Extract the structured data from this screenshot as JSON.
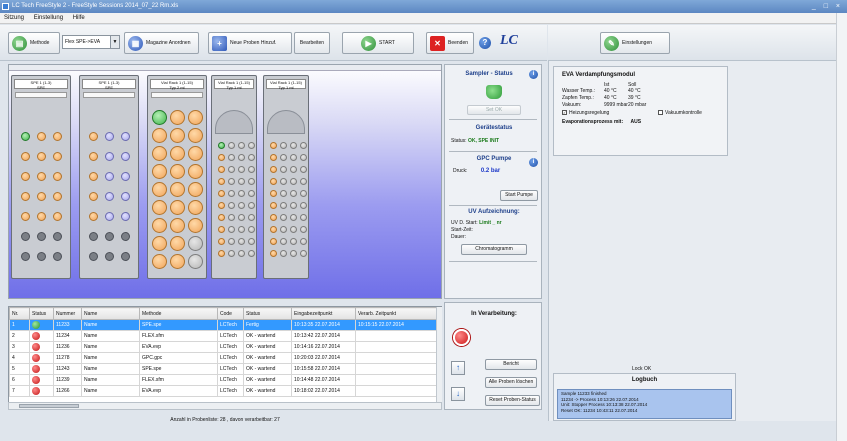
{
  "window": {
    "title": "LC Tech FreeStyle 2 - FreeStyle Sessions 2014_07_22 Rm.xls",
    "controls": "_ □ ×"
  },
  "menu": [
    "Sitzung",
    "Einstellung",
    "Hilfe"
  ],
  "toolbar": {
    "method_label": "Methode",
    "method_select": "Flex SPE->EVA",
    "magazines_label": "Magazine Anordnen",
    "new_samples_label": "Neue Proben Hinzuf.",
    "edit_label": "Bearbeiten",
    "start_label": "START",
    "quit_label": "Beenden",
    "help_glyph": "?",
    "logo_text": "LC"
  },
  "racks": [
    {
      "label": "SPE 1 (1-3)",
      "sub": "SPE"
    },
    {
      "label": "SPE 1 (1-3)",
      "sub": "SPE"
    },
    {
      "label": "Vial Rack 1 (1-15)",
      "sub": "Typ 2 ml"
    },
    {
      "label": "Vial Rack 1 (1-15)",
      "sub": "Typ 1 ml"
    },
    {
      "label": "Vial Rack 1 (1-15)",
      "sub": "Typ 1 ml"
    }
  ],
  "sampler_status": {
    "title": "Sampler - Status",
    "set_ok_label": "Set OK",
    "device_status_title": "Gerätestatus",
    "status_label": "Status:",
    "status_value": "OK, SPE INIT",
    "gpc_title": "GPC Pumpe",
    "pressure_label": "Druck:",
    "pressure_value": "0.2 bar",
    "start_pump_label": "Start Pumpe",
    "uv_title": "UV Aufzeichnung:",
    "uv_line1_label": "UV D. Start:",
    "uv_line1_value": "Limit _ nr",
    "uv_line2_label": "Start-Zeit:",
    "uv_line3_label": "Dauer:",
    "chromatogram_label": "Chromatogramm"
  },
  "table": {
    "columns": [
      "Nr.",
      "Status",
      "Nummer",
      "Name",
      "Methode",
      "Code",
      "Status",
      "Eingabezeitpunkt",
      "Verarb. Zeitpunkt"
    ],
    "rows": [
      {
        "nr": "1",
        "status": "green",
        "nummer": "11233",
        "name": "Name",
        "methode": "SPE.spe",
        "code": "LCTech",
        "st": "Fertig",
        "ein": "10:13:35 22.07.2014",
        "ver": "10:15:15 22.07.2014"
      },
      {
        "nr": "2",
        "status": "red",
        "nummer": "11234",
        "name": "Name",
        "methode": "FLEX.sfm",
        "code": "LCTech",
        "st": "OK - wartend",
        "ein": "10:13:42 22.07.2014",
        "ver": ""
      },
      {
        "nr": "3",
        "status": "red",
        "nummer": "11236",
        "name": "Name",
        "methode": "EVA.evp",
        "code": "LCTech",
        "st": "OK - wartend",
        "ein": "10:14:16 22.07.2014",
        "ver": ""
      },
      {
        "nr": "4",
        "status": "red",
        "nummer": "11278",
        "name": "Name",
        "methode": "GPC.gpc",
        "code": "LCTech",
        "st": "OK - wartend",
        "ein": "10:20:03 22.07.2014",
        "ver": ""
      },
      {
        "nr": "5",
        "status": "red",
        "nummer": "11243",
        "name": "Name",
        "methode": "SPE.spe",
        "code": "LCTech",
        "st": "OK - wartend",
        "ein": "10:15:58 22.07.2014",
        "ver": ""
      },
      {
        "nr": "6",
        "status": "red",
        "nummer": "11239",
        "name": "Name",
        "methode": "FLEX.sfm",
        "code": "LCTech",
        "st": "OK - wartend",
        "ein": "10:14:48 22.07.2014",
        "ver": ""
      },
      {
        "nr": "7",
        "status": "red",
        "nummer": "11266",
        "name": "Name",
        "methode": "EVA.evp",
        "code": "LCTech",
        "st": "OK - wartend",
        "ein": "10:18:02 22.07.2014",
        "ver": ""
      }
    ]
  },
  "summary": "Anzahl in Probenliste: 28 , davon verarbeitbar: 27",
  "processing": {
    "title": "In Verarbeitung:",
    "report_label": "Bericht",
    "delete_all_label": "Alle Proben löschen",
    "reset_label": "Reset Proben-Status",
    "up_glyph": "↑",
    "down_glyph": "↓"
  },
  "settings": {
    "label": "Einstellungen"
  },
  "evaporation": {
    "title": "EVA Verdampfungsmodul",
    "col_ist": "Ist",
    "col_soll": "Soll",
    "rows": [
      {
        "label": "Wasser Temp.:",
        "ist": "40 °C",
        "soll": "40 °C"
      },
      {
        "label": "Zapfen Temp.:",
        "ist": "40 °C",
        "soll": "39 °C"
      },
      {
        "label": "Vakuum:",
        "ist": "9999 mbar",
        "soll": "20 mbar"
      }
    ],
    "heating_label": "Heizungsregelung",
    "vacuum_control_label": "Vakuumkontrolle",
    "process_label": "Evaporationsprozess mit:",
    "process_value": "AUS"
  },
  "lock_status": "Lock OK",
  "log": {
    "title": "Logbuch",
    "lines": [
      "Sample 11233 finished",
      "11234 -> Process 10:13:26 22.07.2014",
      "Unit: Stopper Process 10:13:38 22.07.2014",
      "Reset OK: 11234 10:43:11 22.07.2014"
    ]
  }
}
